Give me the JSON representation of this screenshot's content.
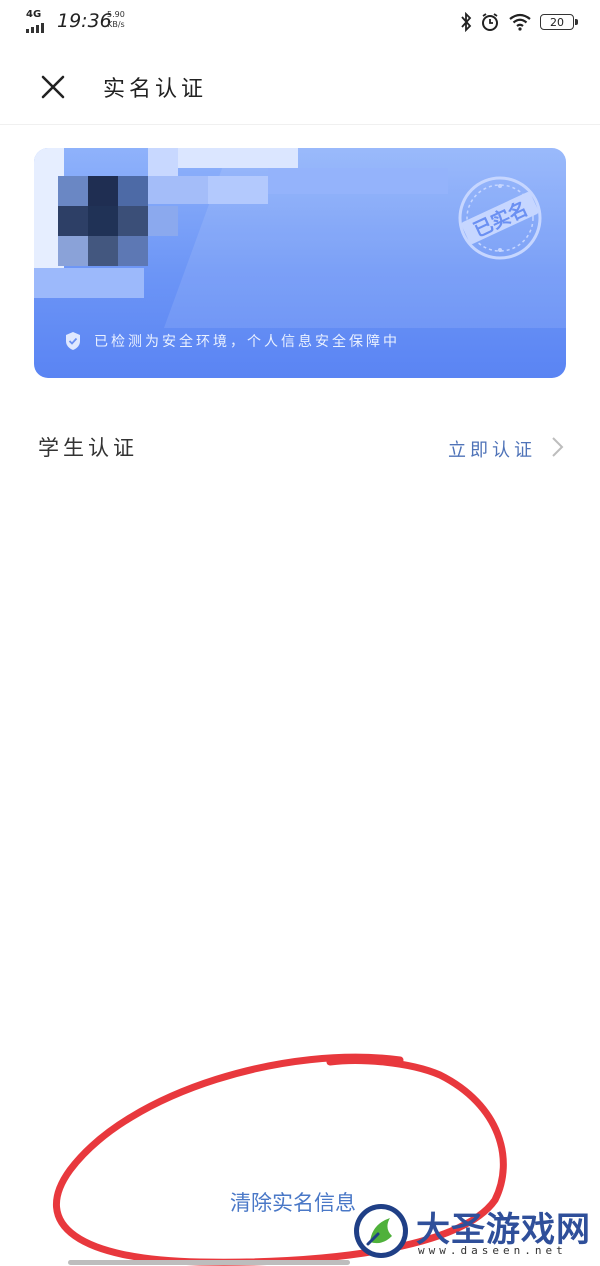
{
  "status_bar": {
    "network": "4G",
    "time": "19:36",
    "speed_value": "5.90",
    "speed_unit": "KB/s",
    "battery": "20",
    "icons": [
      "bluetooth-icon",
      "alarm-icon",
      "wifi-icon",
      "battery-icon"
    ]
  },
  "nav": {
    "title": "实名认证",
    "close_icon": "close-icon"
  },
  "card": {
    "seal_text": "已实名",
    "security_text": "已检测为安全环境，个人信息安全保障中",
    "security_icon": "shield-check-icon",
    "colors": {
      "top": "#8fb2fb",
      "bottom": "#5a84f3"
    }
  },
  "student": {
    "label": "学生认证",
    "action": "立即认证",
    "action_color": "#4f73b8"
  },
  "footer": {
    "clear_button": "清除实名信息",
    "annotation_color": "#e8383d"
  },
  "watermark": {
    "name": "大圣游戏网",
    "url": "www.daseen.net"
  }
}
